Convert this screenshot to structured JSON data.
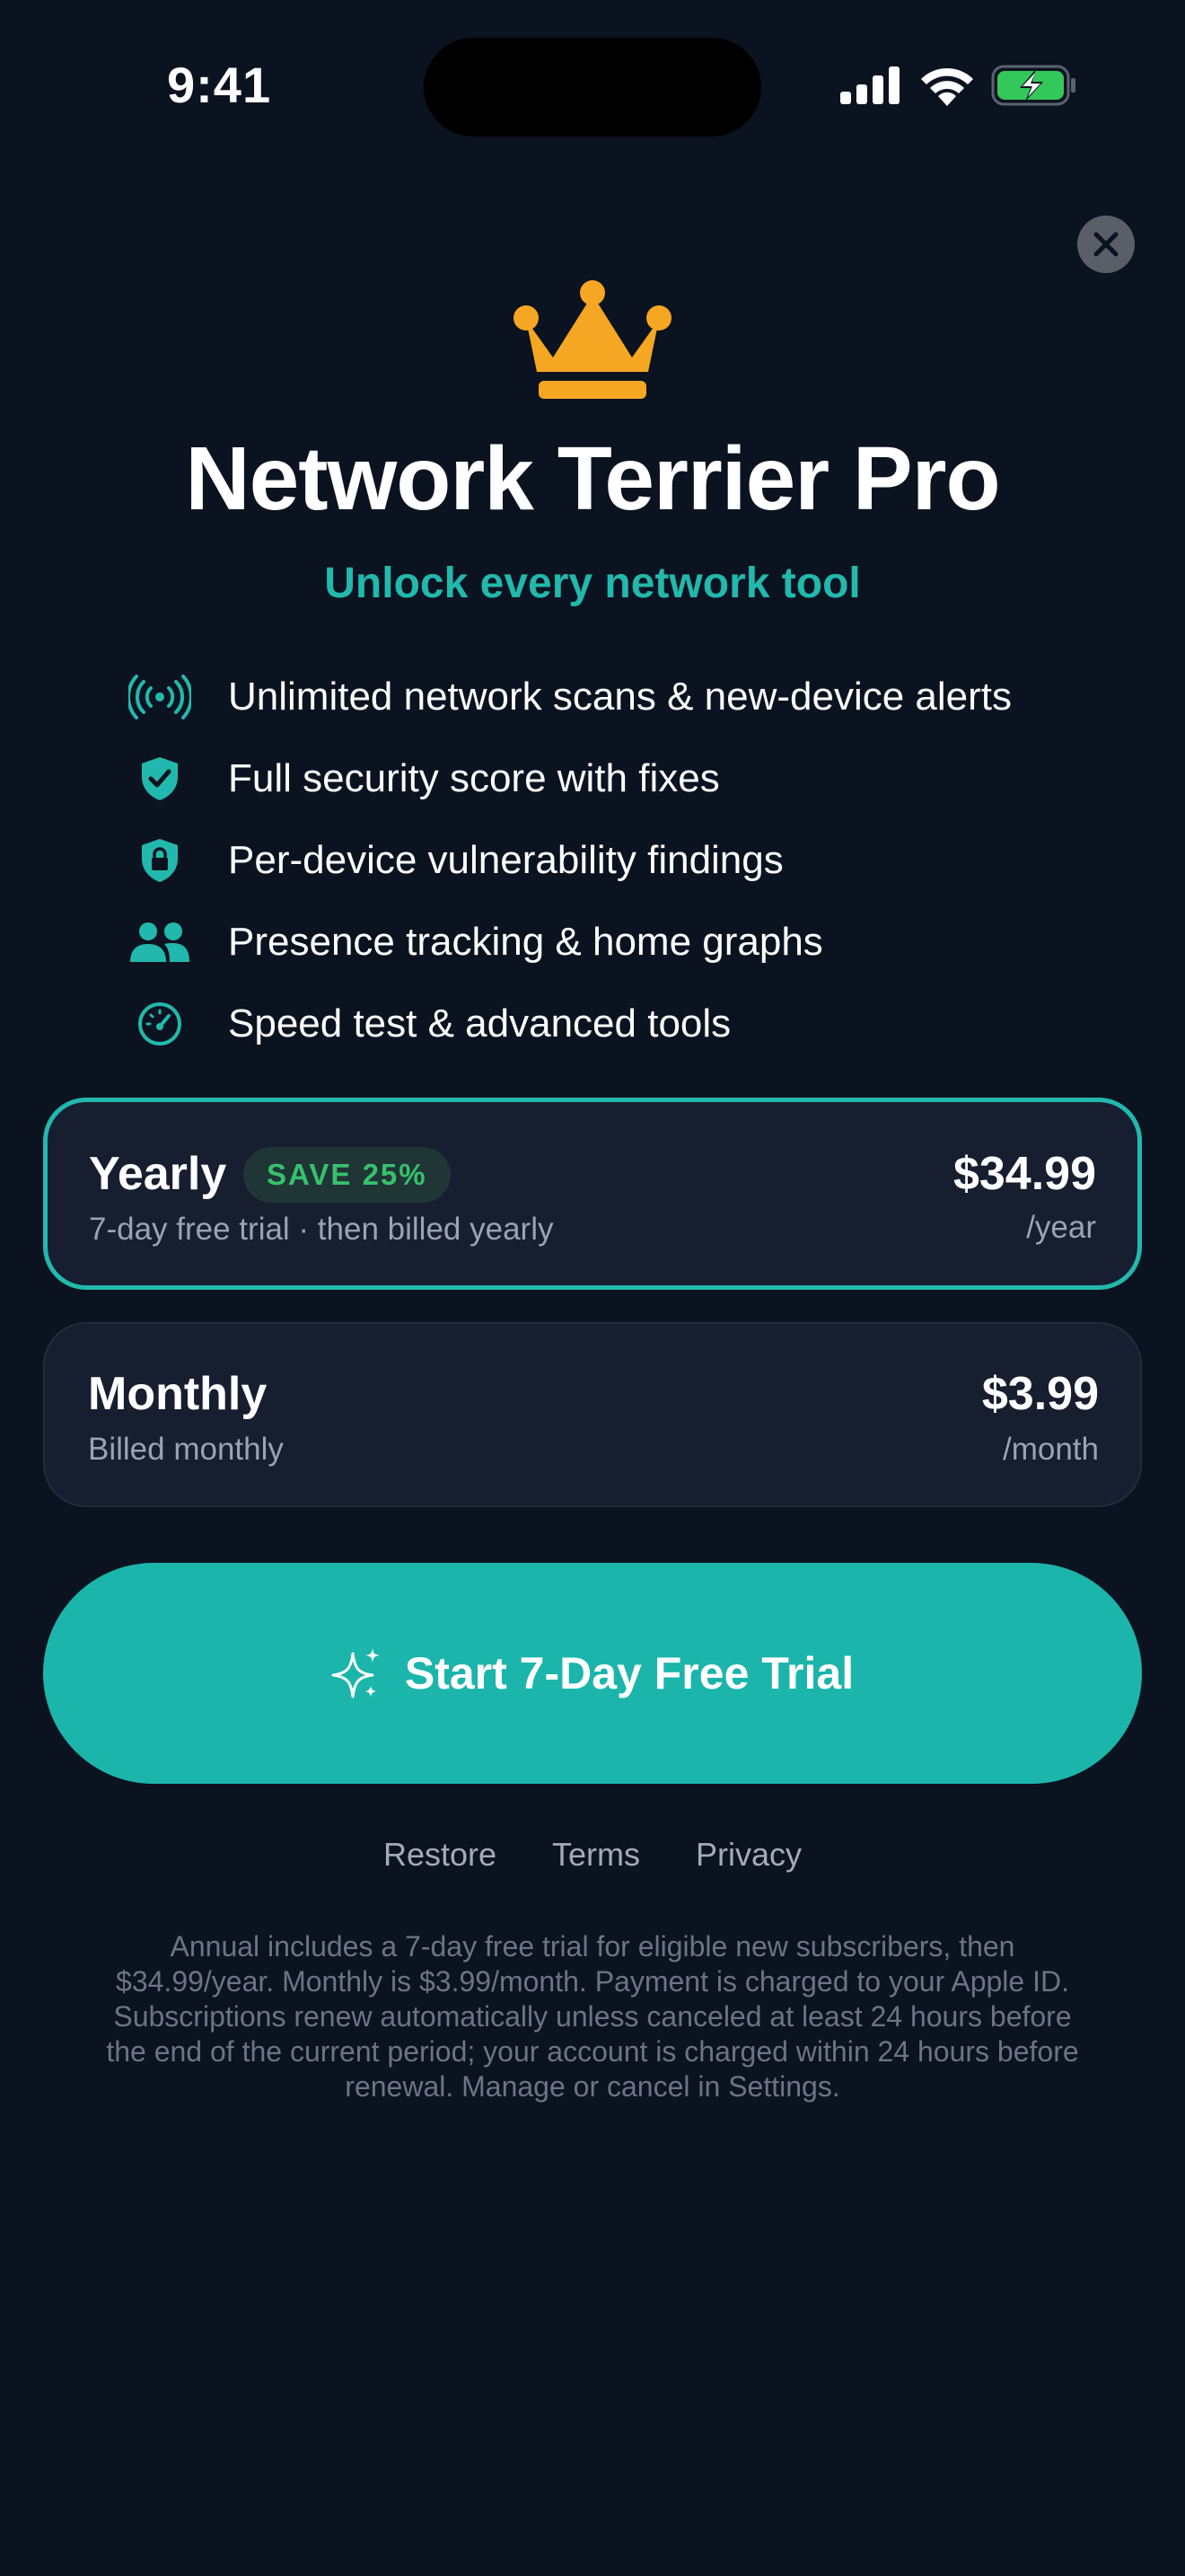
{
  "status_bar": {
    "time": "9:41",
    "icons": [
      "cellular-signal-icon",
      "wifi-icon",
      "battery-charging-icon"
    ]
  },
  "paywall": {
    "close_icon": "close-icon",
    "hero_icon": "crown-icon",
    "title": "Network Terrier Pro",
    "subtitle": "Unlock every network tool",
    "features": [
      {
        "icon": "broadcast-icon",
        "text": "Unlimited network scans & new-device alerts"
      },
      {
        "icon": "shield-check-icon",
        "text": "Full security score with fixes"
      },
      {
        "icon": "shield-lock-icon",
        "text": "Per-device vulnerability findings"
      },
      {
        "icon": "people-icon",
        "text": "Presence tracking & home graphs"
      },
      {
        "icon": "speedometer-icon",
        "text": "Speed test & advanced tools"
      }
    ],
    "plans": {
      "yearly": {
        "name": "Yearly",
        "badge": "SAVE 25%",
        "detail": "7-day free trial · then billed yearly",
        "price": "$34.99",
        "period": "/year",
        "selected": true
      },
      "monthly": {
        "name": "Monthly",
        "detail": "Billed monthly",
        "price": "$3.99",
        "period": "/month",
        "selected": false
      }
    },
    "cta": {
      "icon": "sparkles-icon",
      "label": "Start 7-Day Free Trial"
    },
    "footer_links": {
      "restore": "Restore",
      "terms": "Terms",
      "privacy": "Privacy"
    },
    "legal": "Annual includes a 7-day free trial for eligible new subscribers, then $34.99/year. Monthly is $3.99/month. Payment is charged to your Apple ID. Subscriptions renew automatically unless canceled at least 24 hours before the end of the current period; your account is charged within 24 hours before renewal. Manage or cancel in Settings."
  },
  "colors": {
    "background": "#0b1320",
    "accent_teal": "#1bb5ab",
    "crown_gold": "#f5a623",
    "save_green": "#37c06d",
    "card": "#161e30",
    "battery_green": "#34c759"
  }
}
